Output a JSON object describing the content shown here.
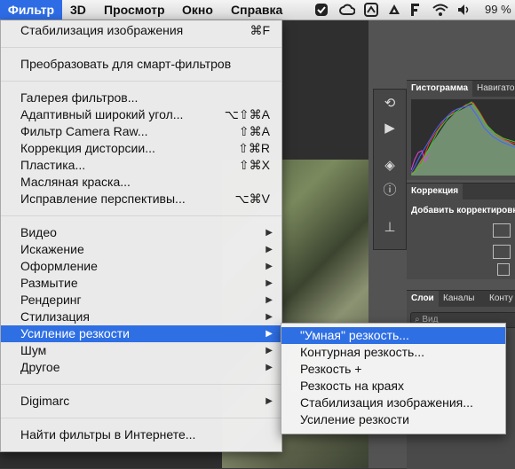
{
  "menubar": {
    "items": [
      {
        "label": "Фильтр",
        "active": true
      },
      {
        "label": "3D"
      },
      {
        "label": "Просмотр"
      },
      {
        "label": "Окно"
      },
      {
        "label": "Справка"
      }
    ],
    "battery": "99 %"
  },
  "filter_menu": {
    "items": [
      {
        "label": "Стабилизация изображения",
        "shortcut": "⌘F"
      },
      {
        "label": "Преобразовать для смарт-фильтров"
      },
      {
        "label": "Галерея фильтров..."
      },
      {
        "label": "Адаптивный широкий угол...",
        "shortcut": "⌥⇧⌘A"
      },
      {
        "label": "Фильтр Camera Raw...",
        "shortcut": "⇧⌘A"
      },
      {
        "label": "Коррекция дисторсии...",
        "shortcut": "⇧⌘R"
      },
      {
        "label": "Пластика...",
        "shortcut": "⇧⌘X"
      },
      {
        "label": "Масляная краска..."
      },
      {
        "label": "Исправление перспективы...",
        "shortcut": "⌥⌘V"
      },
      {
        "label": "Видео"
      },
      {
        "label": "Искажение"
      },
      {
        "label": "Оформление"
      },
      {
        "label": "Размытие"
      },
      {
        "label": "Рендеринг"
      },
      {
        "label": "Стилизация"
      },
      {
        "label": "Усиление резкости",
        "highlighted": true
      },
      {
        "label": "Шум"
      },
      {
        "label": "Другое"
      },
      {
        "label": "Digimarc"
      },
      {
        "label": "Найти фильтры в Интернете..."
      }
    ]
  },
  "submenu": {
    "items": [
      {
        "label": "\"Умная\" резкость...",
        "highlighted": true
      },
      {
        "label": "Контурная резкость..."
      },
      {
        "label": "Резкость +"
      },
      {
        "label": "Резкость на краях"
      },
      {
        "label": "Стабилизация изображения..."
      },
      {
        "label": "Усиление резкости"
      }
    ]
  },
  "panels": {
    "histogram_tab": "Гистограмма",
    "navigator_tab": "Навигато",
    "correction_tab": "Коррекция",
    "correction_add": "Добавить корректировк",
    "layers_tab": "Слои",
    "channels_tab": "Каналы",
    "contours_tab": "Конту",
    "search_placeholder": "Вид"
  },
  "colors": {
    "menu_highlight": "#2f6fe4",
    "panel_bg": "#4a4a4a"
  }
}
